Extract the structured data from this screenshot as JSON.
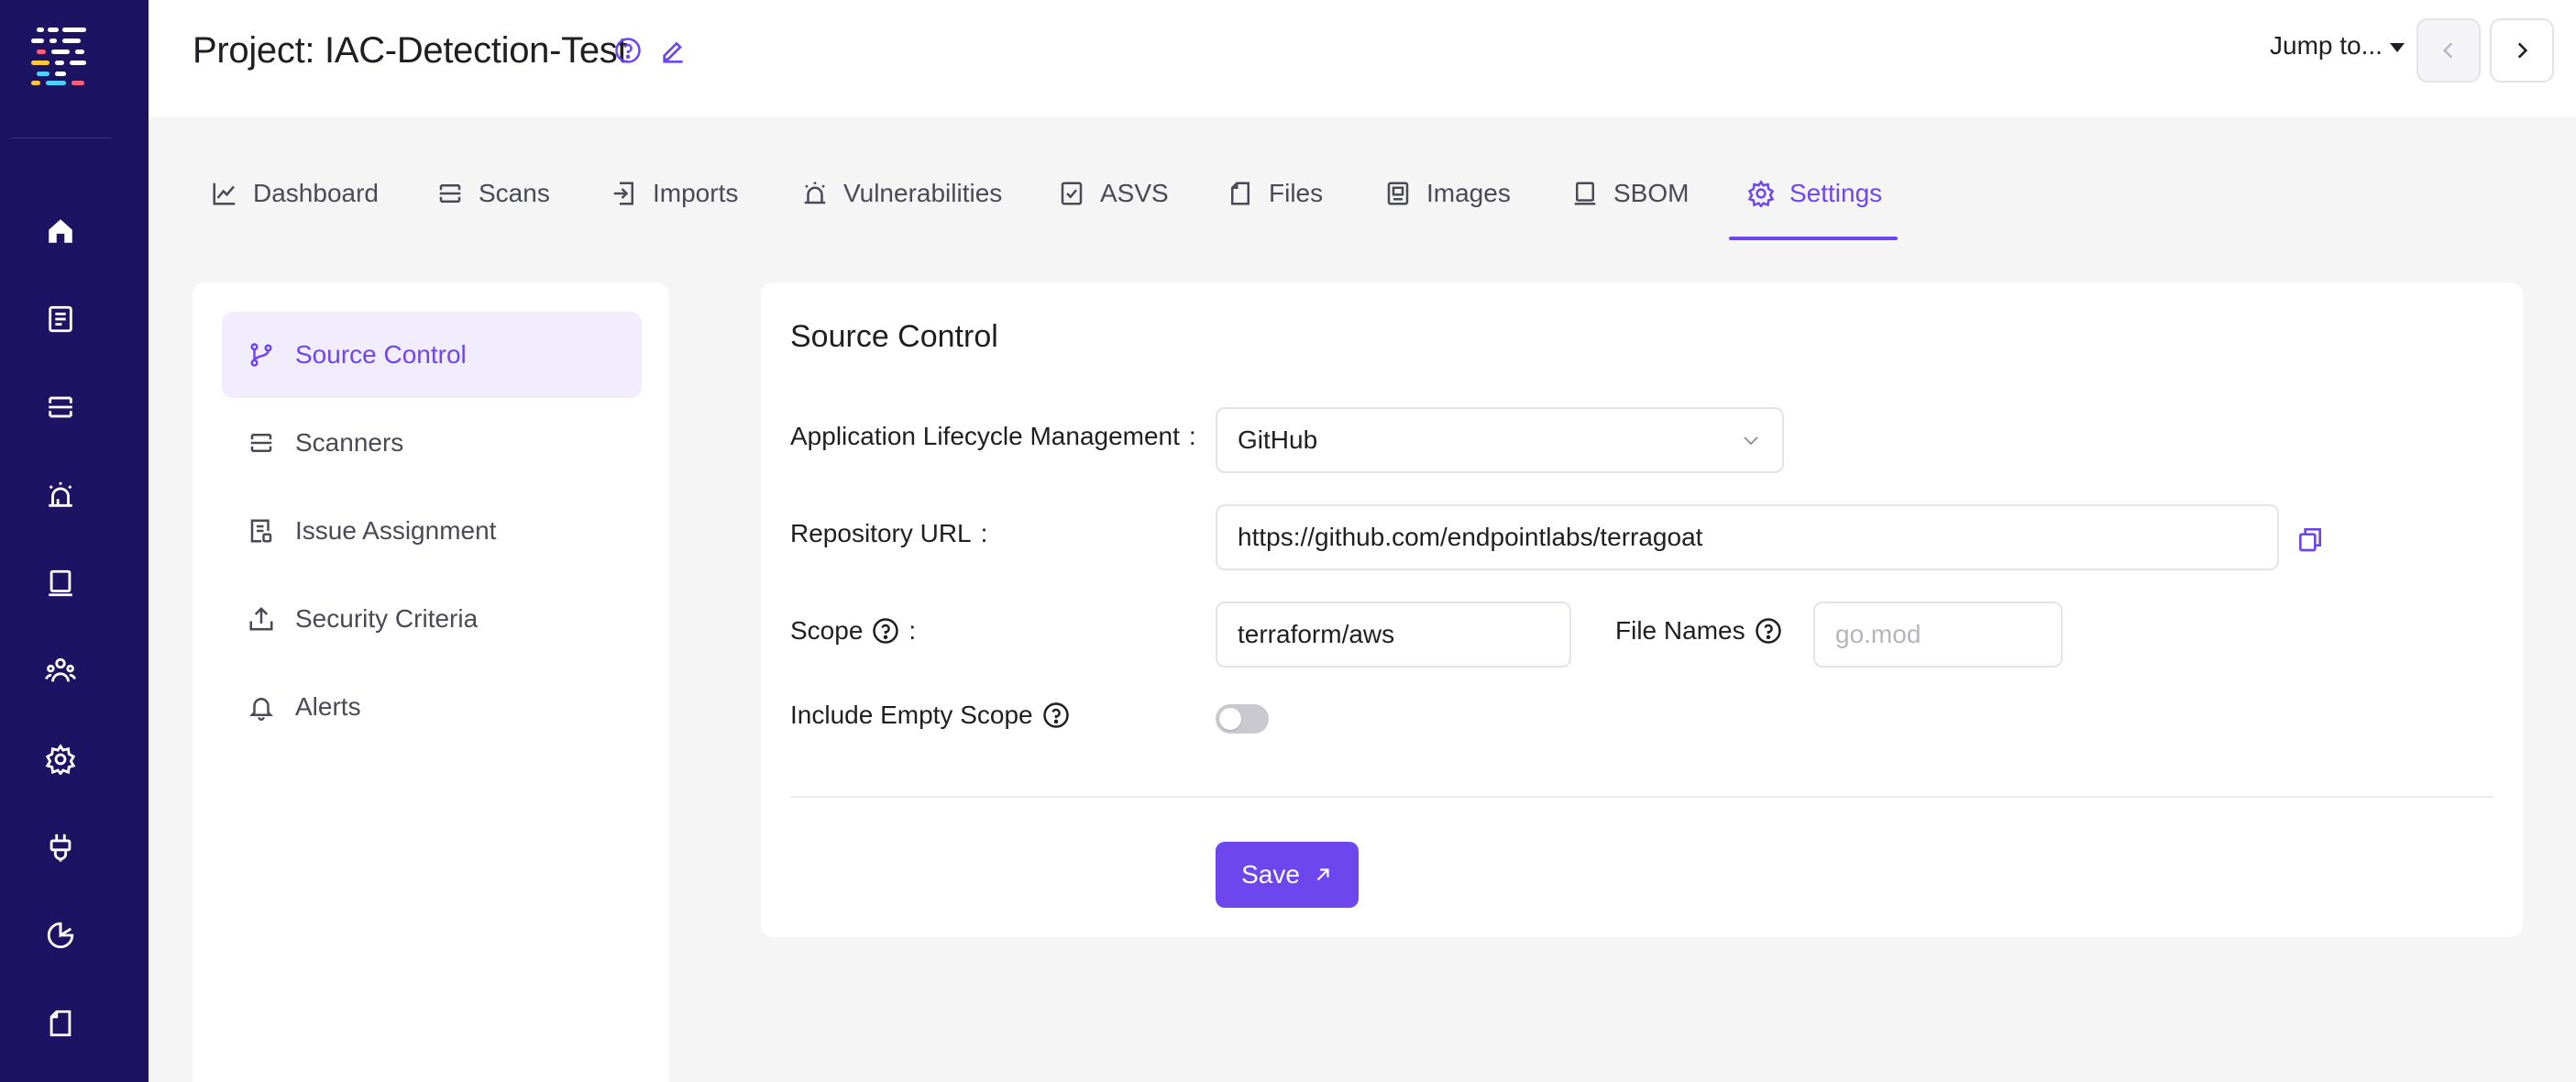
{
  "header": {
    "title": "Project: IAC-Detection-Test",
    "jump_label": "Jump to..."
  },
  "sidebar": {
    "icons": [
      "home-icon",
      "document-icon",
      "scans-icon",
      "alarm-icon",
      "laptop-icon",
      "team-icon",
      "gear-icon",
      "plug-icon",
      "chart-icon",
      "file-icon"
    ]
  },
  "tabs": [
    {
      "label": "Dashboard",
      "icon": "chart-line-icon"
    },
    {
      "label": "Scans",
      "icon": "scans-icon"
    },
    {
      "label": "Imports",
      "icon": "import-icon"
    },
    {
      "label": "Vulnerabilities",
      "icon": "alarm-icon"
    },
    {
      "label": "ASVS",
      "icon": "checkbox-icon"
    },
    {
      "label": "Files",
      "icon": "file-icon"
    },
    {
      "label": "Images",
      "icon": "image-icon"
    },
    {
      "label": "SBOM",
      "icon": "laptop-icon"
    },
    {
      "label": "Settings",
      "icon": "gear-icon",
      "active": true
    }
  ],
  "settings_menu": [
    {
      "label": "Source Control",
      "icon": "branch-icon",
      "active": true
    },
    {
      "label": "Scanners",
      "icon": "scans-icon"
    },
    {
      "label": "Issue Assignment",
      "icon": "assignment-icon"
    },
    {
      "label": "Security Criteria",
      "icon": "upload-icon"
    },
    {
      "label": "Alerts",
      "icon": "bell-icon"
    }
  ],
  "form": {
    "title": "Source Control",
    "alm_label": "Application Lifecycle Management",
    "alm_value": "GitHub",
    "repo_label": "Repository URL",
    "repo_value": "https://github.com/endpointlabs/terragoat",
    "scope_label": "Scope",
    "scope_value": "terraform/aws",
    "file_names_label": "File Names",
    "file_names_placeholder": "go.mod",
    "include_empty_scope_label": "Include Empty Scope",
    "include_empty_scope_on": false,
    "colon": ":",
    "save_label": "Save"
  },
  "colors": {
    "accent": "#6e46ee",
    "sidebar_bg": "#1c1463",
    "page_bg": "#f5f5f6"
  }
}
